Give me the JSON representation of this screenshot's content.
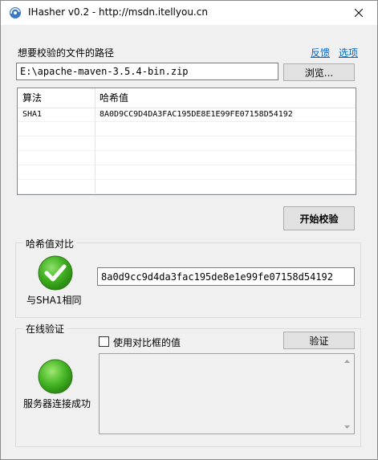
{
  "window": {
    "title": "IHasher v0.2 - http://msdn.itellyou.cn"
  },
  "file": {
    "label": "想要校验的文件的路径",
    "feedback_link": "反馈",
    "options_link": "选项",
    "path_value": "E:\\apache-maven-3.5.4-bin.zip",
    "browse_label": "浏览..."
  },
  "results": {
    "columns": [
      "算法",
      "哈希值"
    ],
    "rows": [
      {
        "algorithm": "SHA1",
        "hash": "8A0D9CC9D4DA3FAC195DE8E1E99FE07158D54192"
      }
    ]
  },
  "actions": {
    "start_label": "开始校验"
  },
  "compare": {
    "group_title": "哈希值对比",
    "input_value": "8a0d9cc9d4da3fac195de8e1e99fe07158d54192",
    "status_text": "与SHA1相同",
    "status_icon": "check-circle-icon",
    "status_color": "#3fae1f"
  },
  "online": {
    "group_title": "在线验证",
    "checkbox_label": "使用对比框的值",
    "checkbox_checked": false,
    "verify_label": "验证",
    "status_text": "服务器连接成功",
    "status_icon": "green-dot-icon",
    "status_color": "#3fae1f"
  }
}
